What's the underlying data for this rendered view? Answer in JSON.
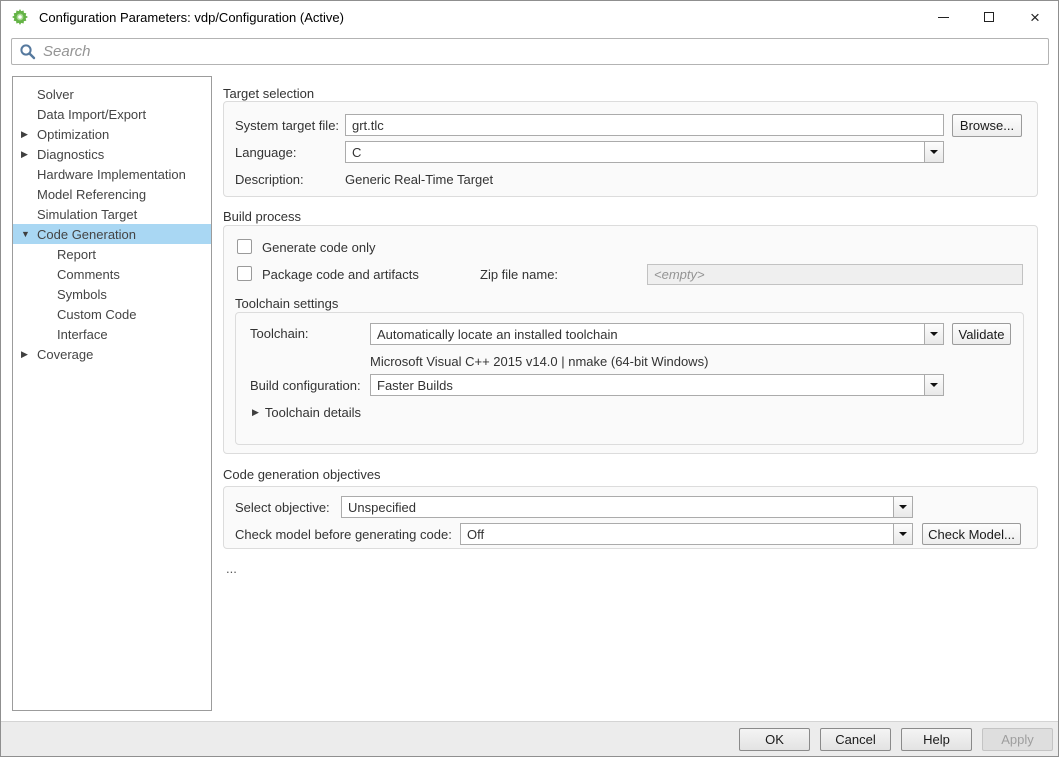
{
  "window": {
    "title": "Configuration Parameters: vdp/Configuration (Active)"
  },
  "search": {
    "placeholder": "Search"
  },
  "sidebar": {
    "items": [
      {
        "label": "Solver",
        "level": 0,
        "arrow": "none",
        "selected": false
      },
      {
        "label": "Data Import/Export",
        "level": 0,
        "arrow": "none",
        "selected": false
      },
      {
        "label": "Optimization",
        "level": 0,
        "arrow": "collapsed",
        "selected": false
      },
      {
        "label": "Diagnostics",
        "level": 0,
        "arrow": "collapsed",
        "selected": false
      },
      {
        "label": "Hardware Implementation",
        "level": 0,
        "arrow": "none",
        "selected": false
      },
      {
        "label": "Model Referencing",
        "level": 0,
        "arrow": "none",
        "selected": false
      },
      {
        "label": "Simulation Target",
        "level": 0,
        "arrow": "none",
        "selected": false
      },
      {
        "label": "Code Generation",
        "level": 0,
        "arrow": "expanded",
        "selected": true
      },
      {
        "label": "Report",
        "level": 1,
        "arrow": "none",
        "selected": false
      },
      {
        "label": "Comments",
        "level": 1,
        "arrow": "none",
        "selected": false
      },
      {
        "label": "Symbols",
        "level": 1,
        "arrow": "none",
        "selected": false
      },
      {
        "label": "Custom Code",
        "level": 1,
        "arrow": "none",
        "selected": false
      },
      {
        "label": "Interface",
        "level": 1,
        "arrow": "none",
        "selected": false
      },
      {
        "label": "Coverage",
        "level": 0,
        "arrow": "collapsed",
        "selected": false
      }
    ]
  },
  "target_selection": {
    "title": "Target selection",
    "system_target_file": {
      "label": "System target file:",
      "value": "grt.tlc"
    },
    "browse_button": "Browse...",
    "language": {
      "label": "Language:",
      "value": "C"
    },
    "description": {
      "label": "Description:",
      "value": "Generic Real-Time Target"
    }
  },
  "build_process": {
    "title": "Build process",
    "generate_code_only_label": "Generate code only",
    "package_code_label": "Package code and artifacts",
    "zip_file_name": {
      "label": "Zip file name:",
      "placeholder": "<empty>"
    },
    "toolchain_settings": {
      "title": "Toolchain settings",
      "toolchain": {
        "label": "Toolchain:",
        "value": "Automatically locate an installed toolchain"
      },
      "validate_button": "Validate",
      "toolchain_description": "Microsoft Visual C++ 2015 v14.0 | nmake (64-bit Windows)",
      "build_configuration": {
        "label": "Build configuration:",
        "value": "Faster Builds"
      },
      "toolchain_details_label": "Toolchain details"
    }
  },
  "objectives": {
    "title": "Code generation objectives",
    "select_objective": {
      "label": "Select objective:",
      "value": "Unspecified"
    },
    "check_model": {
      "label": "Check model before generating code:",
      "value": "Off"
    },
    "check_model_button": "Check Model..."
  },
  "ellipsis": "...",
  "footer": {
    "ok": "OK",
    "cancel": "Cancel",
    "help": "Help",
    "apply": "Apply"
  },
  "colors": {
    "selection_highlight": "#a9d7f3",
    "icon_green": "#64b346",
    "search_icon_blue": "#56799e"
  }
}
